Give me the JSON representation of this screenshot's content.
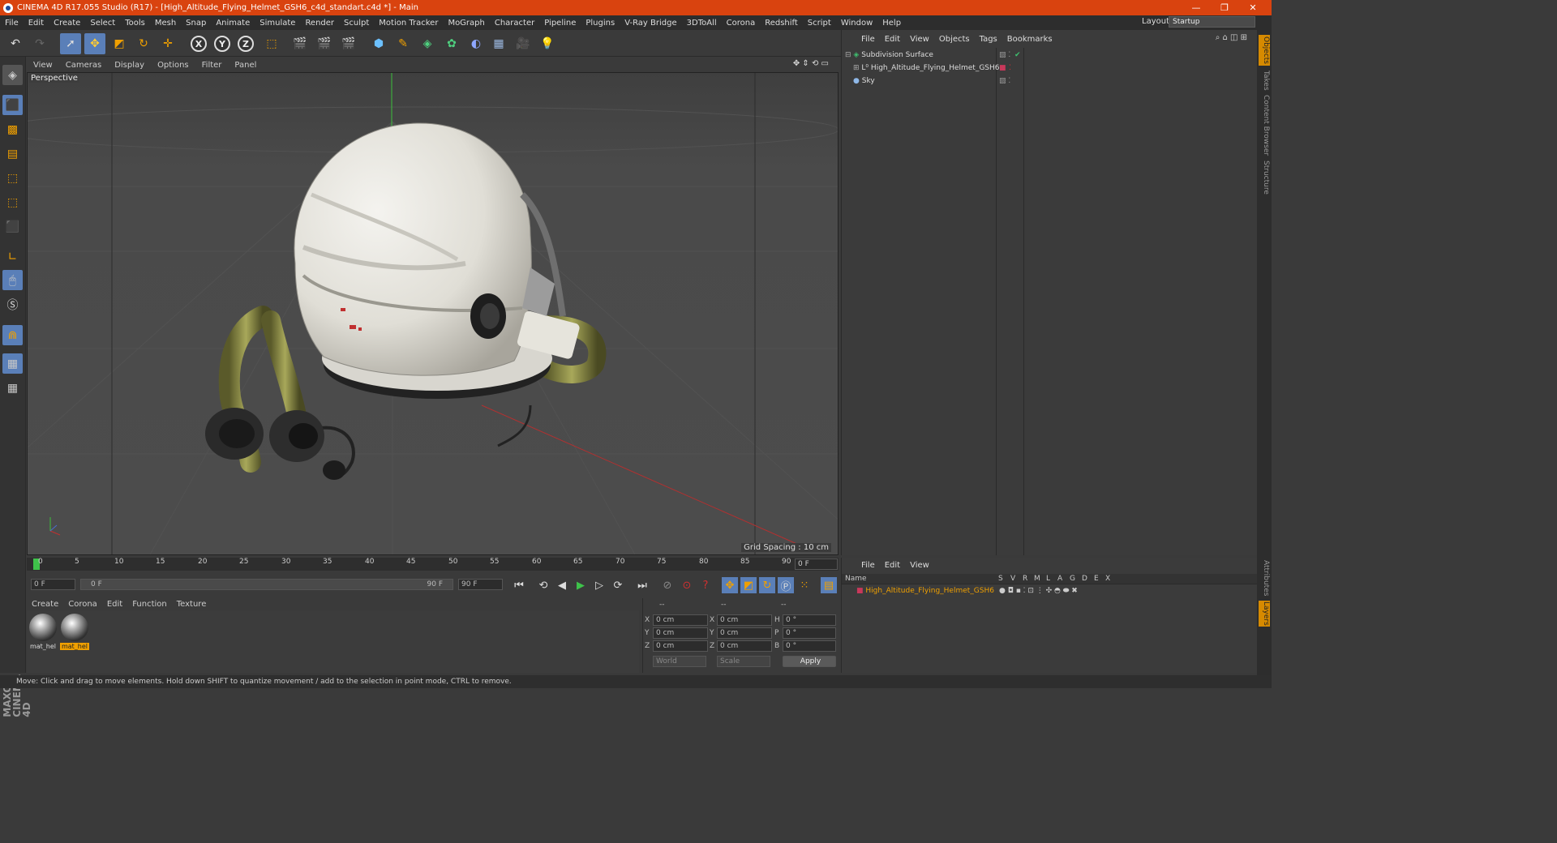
{
  "window": {
    "title": "CINEMA 4D R17.055 Studio (R17) - [High_Altitude_Flying_Helmet_GSH6_c4d_standart.c4d *] - Main",
    "controls": [
      "—",
      "❐",
      "✕"
    ]
  },
  "menu": [
    "File",
    "Edit",
    "Create",
    "Select",
    "Tools",
    "Mesh",
    "Snap",
    "Animate",
    "Simulate",
    "Render",
    "Sculpt",
    "Motion Tracker",
    "MoGraph",
    "Character",
    "Pipeline",
    "Plugins",
    "V-Ray Bridge",
    "3DToAll",
    "Corona",
    "Redshift",
    "Script",
    "Window",
    "Help"
  ],
  "layout": {
    "label": "Layout:",
    "value": "Startup"
  },
  "toolbar": {
    "axis": [
      "X",
      "Y",
      "Z"
    ]
  },
  "viewport": {
    "menu": [
      "View",
      "Cameras",
      "Display",
      "Options",
      "Filter",
      "Panel"
    ],
    "label": "Perspective",
    "grid_spacing": "Grid Spacing : 10 cm"
  },
  "timeline": {
    "ticks": [
      "0",
      "5",
      "10",
      "15",
      "20",
      "25",
      "30",
      "35",
      "40",
      "45",
      "50",
      "55",
      "60",
      "65",
      "70",
      "75",
      "80",
      "85",
      "90"
    ],
    "current": "0 F"
  },
  "transport": {
    "start": "0 F",
    "range_start": "0 F",
    "range_end": "90 F",
    "end": "90 F"
  },
  "materials": {
    "menu": [
      "Create",
      "Corona",
      "Edit",
      "Function",
      "Texture"
    ],
    "items": [
      {
        "name": "mat_hel",
        "active": false
      },
      {
        "name": "mat_hel",
        "active": true
      }
    ]
  },
  "coords": {
    "header": [
      "--",
      "--",
      "--"
    ],
    "rows": [
      {
        "a": "X",
        "av": "0 cm",
        "b": "X",
        "bv": "0 cm",
        "c": "H",
        "cv": "0 °"
      },
      {
        "a": "Y",
        "av": "0 cm",
        "b": "Y",
        "bv": "0 cm",
        "c": "P",
        "cv": "0 °"
      },
      {
        "a": "Z",
        "av": "0 cm",
        "b": "Z",
        "bv": "0 cm",
        "c": "B",
        "cv": "0 °"
      }
    ],
    "world": "World",
    "scale": "Scale",
    "apply": "Apply"
  },
  "objects": {
    "menu": [
      "File",
      "Edit",
      "View",
      "Objects",
      "Tags",
      "Bookmarks"
    ],
    "items": [
      {
        "name": "Subdivision Surface",
        "color": "#3fbf6f"
      },
      {
        "name": "High_Altitude_Flying_Helmet_GSH6",
        "color": "#cfcfcf"
      },
      {
        "name": "Sky",
        "color": "#8fb8e8"
      }
    ]
  },
  "layers": {
    "menu": [
      "File",
      "Edit",
      "View"
    ],
    "header": {
      "name": "Name",
      "cols": [
        "S",
        "V",
        "R",
        "M",
        "L",
        "A",
        "G",
        "D",
        "E",
        "X"
      ]
    },
    "row": {
      "name": "High_Altitude_Flying_Helmet_GSH6",
      "color": "#c8385a"
    }
  },
  "side_tabs": [
    "Objects",
    "Takes",
    "Content Browser",
    "Structure"
  ],
  "side_tabs_lower": [
    "Attributes",
    "Layers"
  ],
  "brand": "MAXON CINEMA 4D",
  "status": "Move: Click and drag to move elements. Hold down SHIFT to quantize movement / add to the selection in point mode, CTRL to remove.",
  "colors": {
    "titlebar": "#d9430f",
    "accent": "#5a7fb8",
    "highlight": "#f0a000"
  }
}
